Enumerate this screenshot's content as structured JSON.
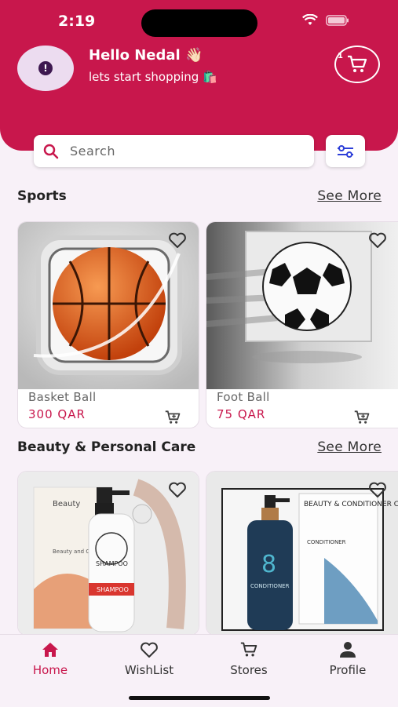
{
  "status": {
    "time": "2:19"
  },
  "header": {
    "greeting": "Hello Nedal 👋🏻",
    "subtitle": "lets start shopping 🛍️",
    "cart_badge": "1"
  },
  "search": {
    "placeholder": "Search"
  },
  "sections": [
    {
      "title": "Sports",
      "see_more": "See More",
      "products": [
        {
          "name": "Basket Ball",
          "price": "300 QAR"
        },
        {
          "name": "Foot Ball",
          "price": "75 QAR"
        }
      ]
    },
    {
      "title": "Beauty & Personal Care",
      "see_more": "See More",
      "products": [
        {
          "name": "",
          "price": "",
          "image_text": {
            "brand_title": "Beauty",
            "brand_sub": "Beauty and Care",
            "label": "SHAMPOO",
            "label2": "SHAMPOO"
          }
        },
        {
          "name": "",
          "price": "",
          "image_text": {
            "box_title": "BEAUTY & CONDITIONER CONDITIONER",
            "box_sub": "CONDITIONER",
            "bottle_num": "8",
            "bottle_label": "CONDITIONER"
          }
        }
      ]
    }
  ],
  "nav": [
    {
      "label": "Home",
      "icon": "home-icon",
      "active": true
    },
    {
      "label": "WishList",
      "icon": "heart-icon",
      "active": false
    },
    {
      "label": "Stores",
      "icon": "cart-icon",
      "active": false
    },
    {
      "label": "Profile",
      "icon": "person-icon",
      "active": false
    }
  ],
  "colors": {
    "primary": "#c8174c",
    "background": "#f8f1f8"
  }
}
